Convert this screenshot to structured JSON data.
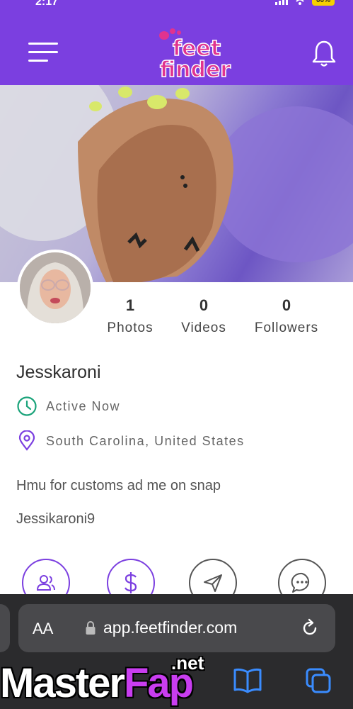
{
  "status_bar": {
    "time": "2:17",
    "battery": "00%"
  },
  "header": {
    "logo_line1": "feet",
    "logo_line2": "finder",
    "menu_icon": "hamburger-menu-icon",
    "bell_icon": "bell-icon"
  },
  "profile": {
    "stats": [
      {
        "value": "1",
        "label": "Photos"
      },
      {
        "value": "0",
        "label": "Videos"
      },
      {
        "value": "0",
        "label": "Followers"
      }
    ],
    "username": "Jesskaroni",
    "status": "Active Now",
    "location": "South Carolina, United States",
    "bio_line1": "Hmu for customs ad me on snap",
    "bio_line2": "Jessikaroni9"
  },
  "actions": [
    {
      "name": "follow-button",
      "icon": "users-icon"
    },
    {
      "name": "tip-button",
      "icon": "dollar-icon"
    },
    {
      "name": "send-button",
      "icon": "send-icon"
    },
    {
      "name": "message-button",
      "icon": "chat-icon"
    }
  ],
  "browser": {
    "aa_label": "AA",
    "url": "app.feetfinder.com"
  },
  "watermark": {
    "part1": "Master",
    "part2": "Fap",
    "suffix": ".net"
  },
  "colors": {
    "brand": "#7b3fe0",
    "active": "#1aa37a",
    "browser_bg": "#2b2b2d"
  }
}
